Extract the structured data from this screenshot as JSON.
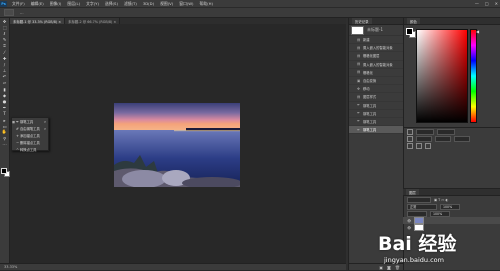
{
  "app": {
    "logo": "Ps"
  },
  "menu": [
    "文件(F)",
    "编辑(E)",
    "图像(I)",
    "图层(L)",
    "文字(Y)",
    "选择(S)",
    "滤镜(T)",
    "3D(D)",
    "视图(V)",
    "窗口(W)",
    "帮助(H)"
  ],
  "window_controls": [
    "—",
    "□",
    "✕"
  ],
  "options": {
    "text": "…"
  },
  "tabs": [
    {
      "label": "未标题-1 @ 33.3% (RGB/8) ×",
      "active": true
    },
    {
      "label": "未标题-2 @ 66.7% (RGB/8) ×",
      "active": false
    }
  ],
  "tools": [
    "move-icon",
    "marquee-icon",
    "lasso-icon",
    "quick-select-icon",
    "crop-icon",
    "eyedropper-icon",
    "healing-icon",
    "brush-icon",
    "stamp-icon",
    "history-brush-icon",
    "eraser-icon",
    "gradient-icon",
    "blur-icon",
    "dodge-icon",
    "pen-icon",
    "type-icon",
    "path-select-icon",
    "shape-icon",
    "hand-icon",
    "zoom-icon",
    "more-icon"
  ],
  "flyout": {
    "items": [
      {
        "label": "钢笔工具",
        "key": "P",
        "icon": "pen-icon"
      },
      {
        "label": "自由钢笔工具",
        "key": "P",
        "icon": "freeform-pen-icon"
      },
      {
        "label": "添加锚点工具",
        "key": "",
        "icon": "add-anchor-icon"
      },
      {
        "label": "删除锚点工具",
        "key": "",
        "icon": "delete-anchor-icon"
      },
      {
        "label": "转换点工具",
        "key": "",
        "icon": "convert-point-icon"
      }
    ]
  },
  "status": {
    "zoom": "33.33%"
  },
  "history": {
    "tab": "历史记录",
    "snapshot_label": "未标题-1",
    "items": [
      "新建",
      "置入嵌入的智能对象",
      "栅格化图层",
      "置入嵌入的智能对象",
      "栅格化",
      "自由变换",
      "移动",
      "图层样式",
      "钢笔工具",
      "钢笔工具",
      "钢笔工具",
      "钢笔工具"
    ],
    "selected_index": 11
  },
  "color_panel": {
    "tab": "颜色",
    "fg": "#000000",
    "bg": "#ffffff"
  },
  "layers_panel": {
    "tab": "图层",
    "blend": "正常",
    "opacity": "100%",
    "fill": "100%"
  },
  "watermark": {
    "brand": "Bai 经验",
    "url": "jingyan.baidu.com"
  }
}
